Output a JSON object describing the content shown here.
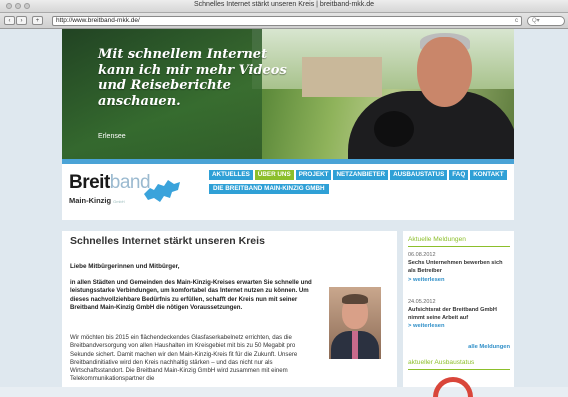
{
  "window": {
    "title": "Schnelles Internet stärkt unseren Kreis | breitband-mkk.de"
  },
  "toolbar": {
    "back_icon": "‹",
    "forward_icon": "›",
    "add_icon": "+",
    "url": "http://www.breitband-mkk.de/",
    "reload_icon": "c",
    "search_placeholder": "Q▾"
  },
  "hero": {
    "slogan": "Mit schnellem Internet kann ich mir mehr Videos und Reiseberichte anschauen.",
    "place": "Erlensee"
  },
  "logo": {
    "breit": "Breit",
    "band": "band",
    "sub": "Main-Kinzig",
    "sub_small": "GmbH"
  },
  "nav": {
    "items": [
      {
        "label": "AKTUELLES",
        "active": false
      },
      {
        "label": "ÜBER UNS",
        "active": true
      },
      {
        "label": "PROJEKT",
        "active": false
      },
      {
        "label": "NETZANBIETER",
        "active": false
      },
      {
        "label": "AUSBAUSTATUS",
        "active": false
      },
      {
        "label": "FAQ",
        "active": false
      },
      {
        "label": "KONTAKT",
        "active": false
      }
    ],
    "sub_item": "DIE BREITBAND MAIN-KINZIG GMBH"
  },
  "main": {
    "title": "Schnelles Internet stärkt unseren Kreis",
    "greeting": "Liebe Mitbürgerinnen und Mitbürger,",
    "lead": "in allen Städten und Gemeinden des Main-Kinzig-Kreises erwarten Sie schnelle und leistungsstarke Verbindungen, um komfortabel das Internet nutzen zu können. Um dieses nachvollziehbare Bedürfnis zu erfüllen, schafft der Kreis nun mit seiner Breitband Main-Kinzig GmbH die nötigen Voraussetzungen.",
    "body": "Wir möchten bis 2015 ein flächendeckendes Glasfaserkabelnetz errichten, das die Breitbandversorgung von allen Haushalten im Kreisgebiet mit bis zu 50 Megabit pro Sekunde sichert. Damit machen wir den Main-Kinzig-Kreis fit für die Zukunft. Unsere Breitbandinitiative wird den Kreis nachhaltig stärken – und das nicht nur als Wirtschaftsstandort. Die Breitband Main-Kinzig GmbH wird zusammen mit einem Telekommunikationspartner die"
  },
  "sidebar": {
    "news_heading": "Aktuelle Meldungen",
    "news": [
      {
        "date": "06.08.2012",
        "title": "Sechs Unternehmen bewerben sich als Betreiber",
        "more": "> weiterlesen"
      },
      {
        "date": "24.05.2012",
        "title": "Aufsichtsrat der Breitband GmbH nimmt seine Arbeit auf",
        "more": "> weiterlesen"
      }
    ],
    "all_news": "alle Meldungen",
    "status_heading": "aktueller Ausbaustatus"
  },
  "colors": {
    "accent_blue": "#2fa0d6",
    "accent_green": "#8cbf2b"
  }
}
